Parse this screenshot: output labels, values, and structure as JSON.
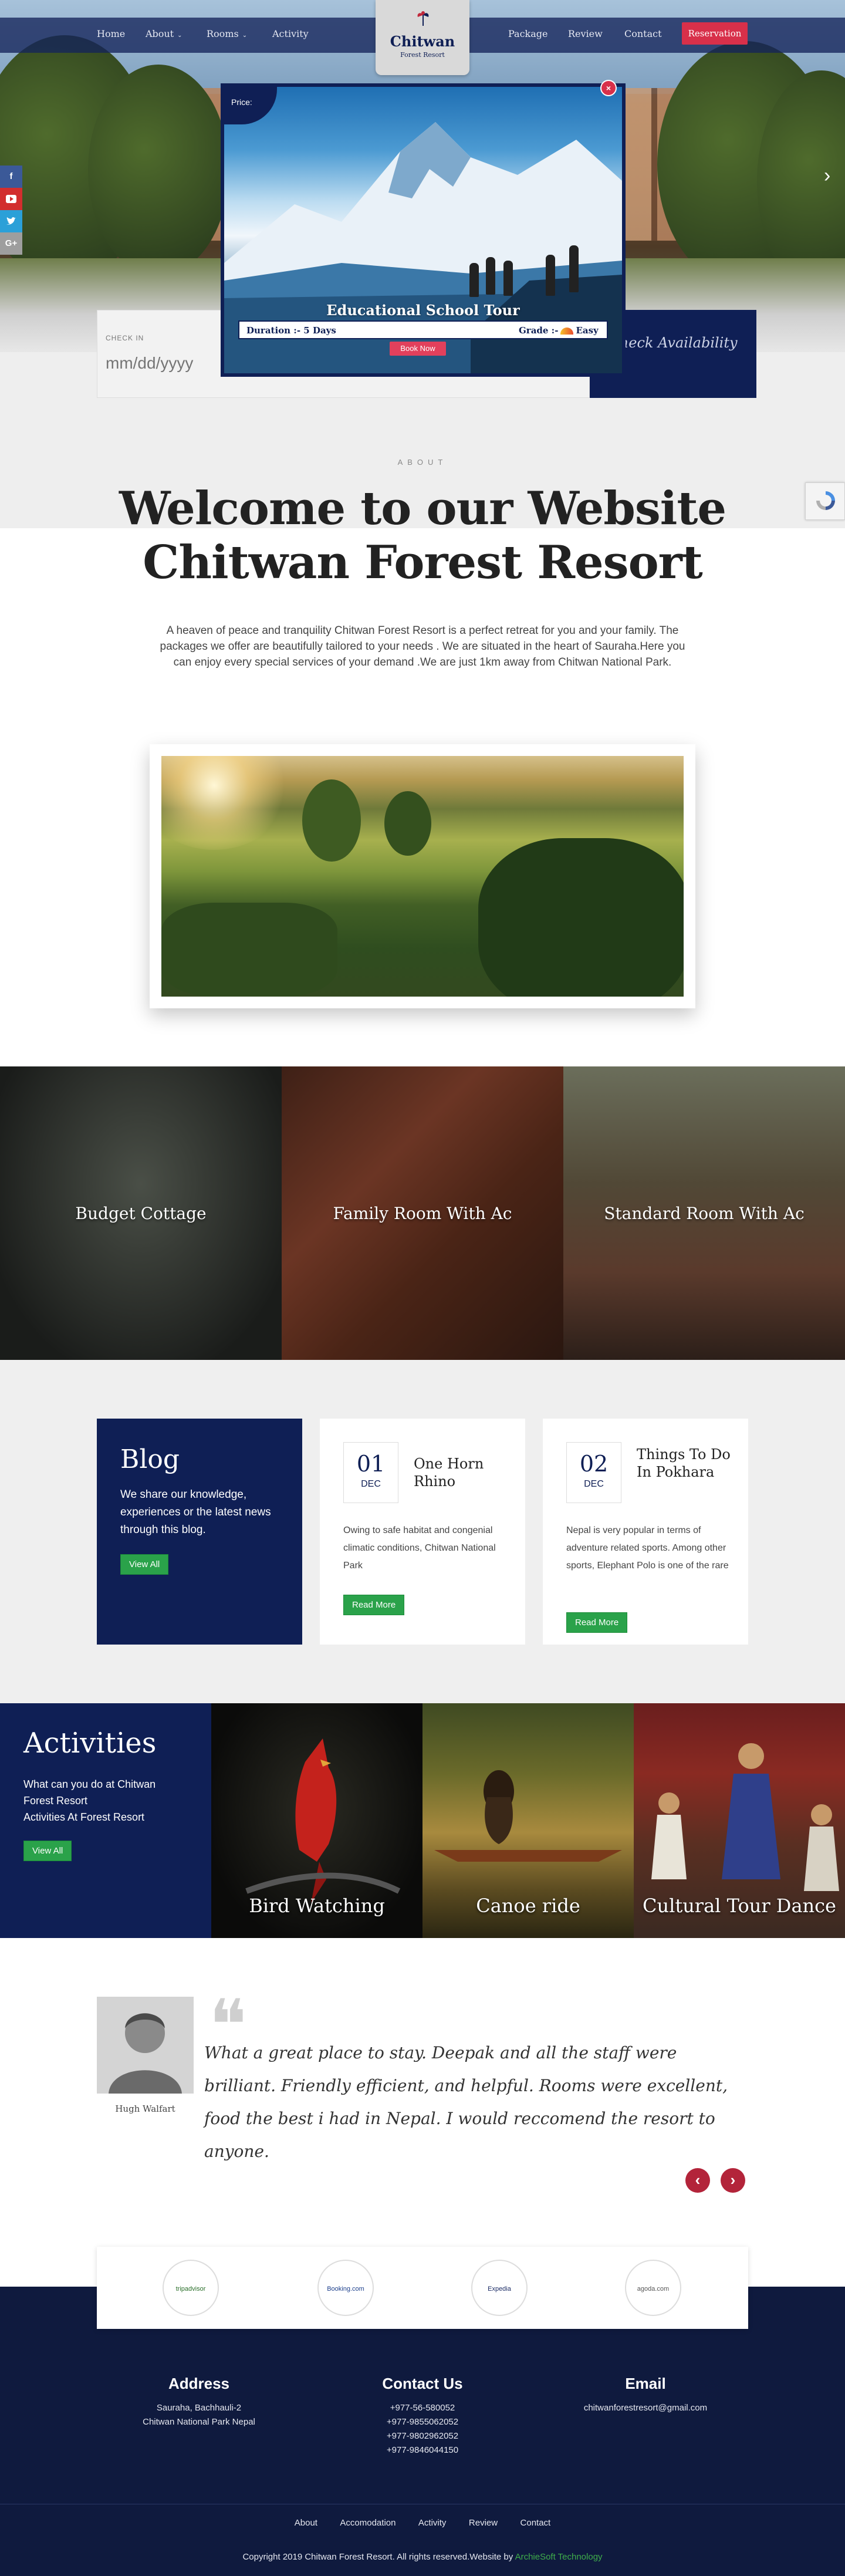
{
  "header": {
    "nav_left": [
      "Home",
      "About",
      "Rooms",
      "Activity"
    ],
    "nav_right": [
      "Package",
      "Review",
      "Contact"
    ],
    "logo_title": "Chitwan",
    "logo_subtitle": "Forest Resort",
    "reservation_label": "Reservation"
  },
  "social": [
    "f",
    "yt",
    "t",
    "G+"
  ],
  "popup": {
    "price_label": "Price:",
    "title": "Educational School Tour",
    "duration": "Duration :- 5 Days",
    "grade": "Grade :-",
    "grade_value": "Easy",
    "book_label": "Book Now",
    "close_label": "×"
  },
  "booking": {
    "checkin_label": "CHECK IN",
    "checkin_placeholder": "mm/dd/yyyy",
    "check_button": "Check Availability"
  },
  "about": {
    "eyebrow": "ABOUT",
    "title_line1": "Welcome to our Website",
    "title_line2": "Chitwan Forest Resort",
    "text": "A heaven of peace and tranquility Chitwan Forest Resort is a perfect retreat for you and your family. The packages we offer are beautifully tailored to your needs . We are situated in the heart of Sauraha.Here you can enjoy every special services of your demand .We are just 1km away from Chitwan National Park."
  },
  "rooms": [
    "Budget Cottage",
    "Family Room With Ac",
    "Standard Room With Ac"
  ],
  "blog": {
    "title": "Blog",
    "description": "We share our knowledge, experiences or the latest news through this blog.",
    "view_all": "View All",
    "posts": [
      {
        "day": "01",
        "month": "DEC",
        "title": "One Horn Rhino",
        "excerpt": "Owing to safe habitat and congenial climatic conditions, Chitwan National Park",
        "read_more": "Read More"
      },
      {
        "day": "02",
        "month": "DEC",
        "title": "Things To Do In Pokhara",
        "excerpt": "Nepal is very popular in terms of adventure related sports. Among other sports, Elephant Polo is one of the rare",
        "read_more": "Read More"
      }
    ]
  },
  "activities": {
    "title": "Activities",
    "description_line1": "What can you do at Chitwan Forest Resort",
    "description_line2": "Activities At Forest Resort",
    "view_all": "View All",
    "items": [
      "Bird Watching",
      "Canoe ride",
      "Cultural Tour Dance"
    ]
  },
  "testimonial": {
    "reviewer": "Hugh Walfart",
    "quote": "What a great place to stay. Deepak and all the staff were brilliant. Friendly efficient, and helpful. Rooms were excellent, food the best i had in Nepal. I would reccomend the resort to anyone.",
    "prev": "‹",
    "next": "›"
  },
  "partners": [
    "tripadvisor",
    "Booking.com",
    "Expedia",
    "agoda.com"
  ],
  "footer": {
    "address_title": "Address",
    "address_lines": [
      "Sauraha, Bachhauli-2",
      "Chitwan National Park Nepal"
    ],
    "contact_title": "Contact Us",
    "phones": [
      "+977-56-580052",
      "+977-9855062052",
      "+977-9802962052",
      "+977-9846044150"
    ],
    "email_title": "Email",
    "email": "chitwanforestresort@gmail.com",
    "nav": [
      "About",
      "Accomodation",
      "Activity",
      "Review",
      "Contact"
    ],
    "copyright": "Copyright 2019 Chitwan Forest Resort. All rights reserved.Website by ",
    "copyright_brand": "ArchieSoft Technology"
  },
  "colors": {
    "navy": "#0f1f55",
    "footer_navy": "#0f1a3e",
    "accent_red": "#d8304a",
    "button_green": "#2aa24a"
  }
}
